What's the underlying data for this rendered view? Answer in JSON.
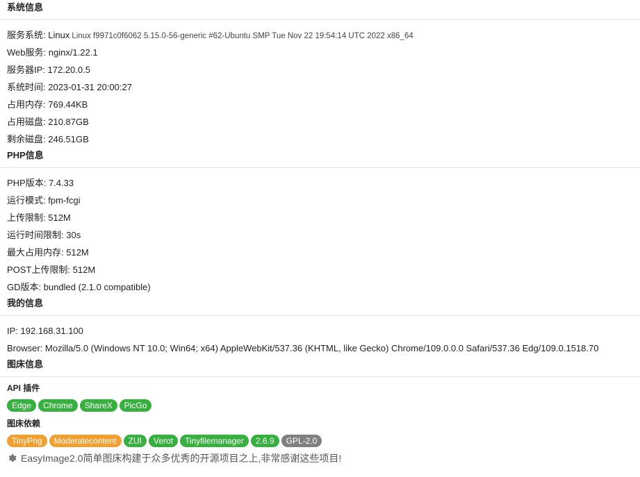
{
  "sections": {
    "system": {
      "title": "系统信息",
      "os_label": "服务系统: ",
      "os_value": "Linux",
      "os_detail": "Linux f9971c0f6062 5.15.0-56-generic #62-Ubuntu SMP Tue Nov 22 19:54:14 UTC 2022 x86_64",
      "rows": [
        {
          "label": "Web服务: ",
          "value": "nginx/1.22.1"
        },
        {
          "label": "服务器IP: ",
          "value": "172.20.0.5"
        },
        {
          "label": "系统时间: ",
          "value": "2023-01-31 20:00:27"
        },
        {
          "label": "占用内存: ",
          "value": "769.44KB"
        },
        {
          "label": "占用磁盘: ",
          "value": "210.87GB"
        },
        {
          "label": "剩余磁盘: ",
          "value": "246.51GB"
        }
      ]
    },
    "php": {
      "title": "PHP信息",
      "rows": [
        {
          "label": "PHP版本: ",
          "value": "7.4.33"
        },
        {
          "label": "运行模式: ",
          "value": "fpm-fcgi"
        },
        {
          "label": "上传限制: ",
          "value": "512M"
        },
        {
          "label": "运行时间限制: ",
          "value": "30s"
        },
        {
          "label": "最大占用内存: ",
          "value": "512M"
        },
        {
          "label": "POST上传限制: ",
          "value": "512M"
        },
        {
          "label": "GD版本: ",
          "value": "bundled (2.1.0 compatible)"
        }
      ]
    },
    "mine": {
      "title": "我的信息",
      "rows": [
        {
          "label": "IP: ",
          "value": "192.168.31.100"
        },
        {
          "label": "Browser: ",
          "value": "Mozilla/5.0 (Windows NT 10.0; Win64; x64) AppleWebKit/537.36 (KHTML, like Gecko) Chrome/109.0.0.0 Safari/537.36 Edg/109.0.1518.70"
        }
      ]
    },
    "bed": {
      "title": "图床信息",
      "api_title": "API 插件",
      "api_badges": [
        "Edge",
        "Chrome",
        "ShareX",
        "PicGo"
      ],
      "deps_title": "图床依赖",
      "deps_badges": [
        {
          "text": "TinyPng",
          "color": "#f0a030"
        },
        {
          "text": "Moderatecontent",
          "color": "#f0a030"
        },
        {
          "text": "ZUI",
          "color": "#38b03f"
        },
        {
          "text": "Verot",
          "color": "#38b03f"
        },
        {
          "text": "Tinyfilemanager",
          "color": "#38b03f"
        },
        {
          "text": "2.6.9",
          "color": "#38b03f"
        },
        {
          "text": "GPL-2.0",
          "color": "#808080"
        }
      ],
      "footer": "EasyImage2.0简单图床构建于众多优秀的开源项目之上,非常感谢这些项目!"
    }
  },
  "colors": {
    "green": "#38b03f",
    "orange": "#f0a030",
    "gray": "#808080"
  }
}
